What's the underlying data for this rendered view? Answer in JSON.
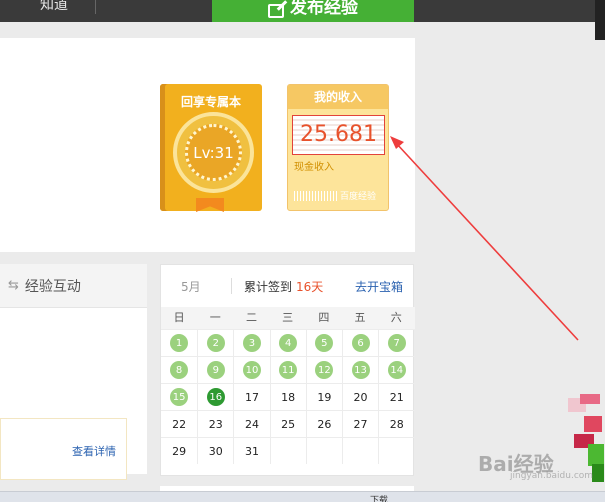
{
  "topbar": {
    "nav_label": "知道",
    "publish_label": "发布经验"
  },
  "level_card": {
    "title": "回享专属本",
    "level": "Lv:31"
  },
  "income_card": {
    "title": "我的收入",
    "amount": "25.681",
    "subtitle": "现金收入",
    "brand": "百度经验"
  },
  "interact": {
    "tab_label": "经验互动",
    "detail_link": "查看详情"
  },
  "calendar": {
    "month": "5月",
    "sign_label": "累计签到",
    "days_count": "16天",
    "chest_link": "去开宝箱",
    "weekdays": [
      "日",
      "一",
      "二",
      "三",
      "四",
      "五",
      "六"
    ],
    "rows": [
      [
        "1",
        "2",
        "3",
        "4",
        "5",
        "6",
        "7"
      ],
      [
        "8",
        "9",
        "10",
        "11",
        "12",
        "13",
        "14"
      ],
      [
        "15",
        "16",
        "17",
        "18",
        "19",
        "20",
        "21"
      ],
      [
        "22",
        "23",
        "24",
        "25",
        "26",
        "27",
        "28"
      ],
      [
        "29",
        "30",
        "31",
        "",
        "",
        "",
        ""
      ]
    ],
    "signed_days": [
      "1",
      "2",
      "3",
      "4",
      "5",
      "6",
      "7",
      "8",
      "9",
      "10",
      "11",
      "12",
      "13",
      "14",
      "15"
    ],
    "today": "16"
  },
  "status_bar": {
    "download_label": "下载"
  },
  "watermark": {
    "text": "Bai经验",
    "sub": "jingyan.baidu.com"
  },
  "colors": {
    "accent_green": "#45b035",
    "signed_green": "#9bd17e",
    "today_green": "#2e9a32",
    "highlight_red": "#e2433a",
    "link_blue": "#2b62b0"
  }
}
